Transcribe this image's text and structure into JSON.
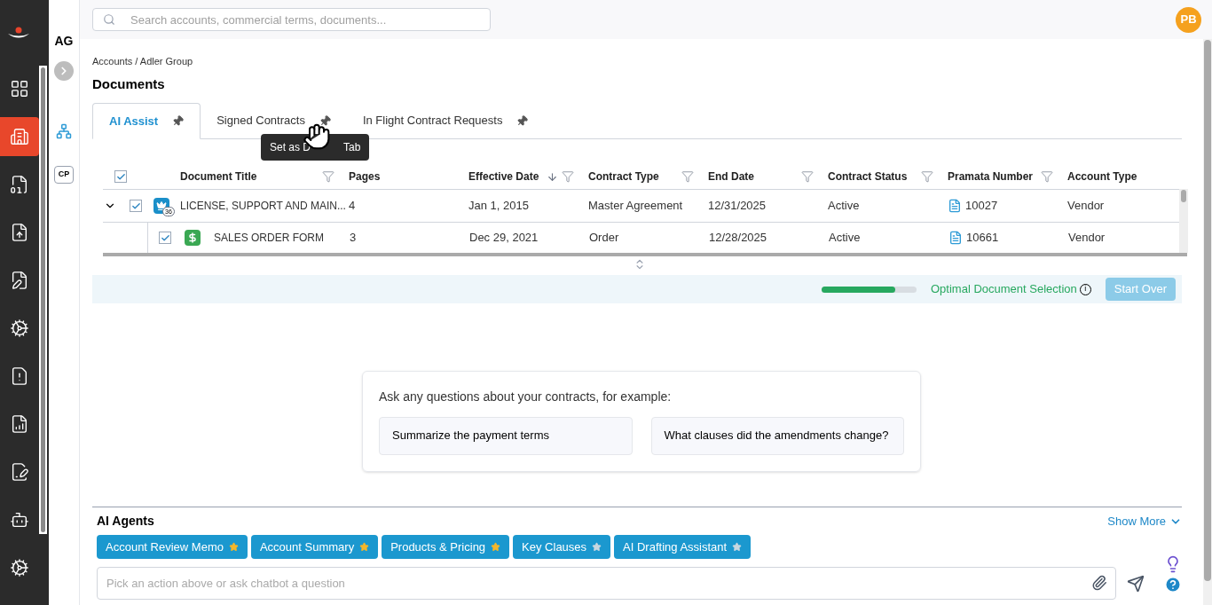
{
  "top_bar": {
    "search": {
      "placeholder": "Search accounts, commercial terms, documents..."
    },
    "avatar": "PB"
  },
  "nav": {
    "items": [
      {
        "kind": "grid",
        "selected": false
      },
      {
        "kind": "building",
        "selected": true
      },
      {
        "kind": "dollar-doc",
        "selected": false
      },
      {
        "kind": "upload-doc",
        "selected": false
      },
      {
        "kind": "edit-doc",
        "selected": false
      },
      {
        "kind": "gear",
        "selected": false
      },
      {
        "kind": "warning-doc",
        "selected": false
      },
      {
        "kind": "chart-doc",
        "selected": false
      },
      {
        "kind": "sign-doc",
        "selected": false
      },
      {
        "kind": "bot",
        "selected": false
      },
      {
        "kind": "gear",
        "selected": false
      }
    ]
  },
  "account_rail": {
    "initials": "AG",
    "tag": "CP"
  },
  "breadcrumb": "Accounts / Adler Group",
  "page_title": "Documents",
  "tabs": [
    {
      "label": "AI Assist",
      "selected": true
    },
    {
      "label": "Signed Contracts",
      "selected": false
    },
    {
      "label": "In Flight Contract Requests",
      "selected": false
    }
  ],
  "tooltip": {
    "before": "Set as D",
    "after": "Tab"
  },
  "table": {
    "header_checked": true,
    "columns": [
      {
        "label": "Document Title",
        "filter": true,
        "sorted": false
      },
      {
        "label": "Pages",
        "filter": false,
        "sorted": false
      },
      {
        "label": "Effective Date",
        "filter": true,
        "sorted": true
      },
      {
        "label": "Contract Type",
        "filter": true,
        "sorted": false
      },
      {
        "label": "End Date",
        "filter": true,
        "sorted": false
      },
      {
        "label": "Contract Status",
        "filter": true,
        "sorted": false
      },
      {
        "label": "Pramata Number",
        "filter": true,
        "sorted": false
      },
      {
        "label": "Account Type",
        "filter": false,
        "sorted": false
      }
    ],
    "rows": [
      {
        "checked": true,
        "expanded": true,
        "kind": "master",
        "badge": "36",
        "cells": [
          "LICENSE, SUPPORT AND MAIN...",
          "4",
          "Jan 1, 2015",
          "Master Agreement",
          "12/31/2025",
          "Active",
          "10027",
          "Vendor"
        ],
        "children": [
          {
            "checked": true,
            "kind": "order",
            "cells": [
              "SALES ORDER FORM",
              "3",
              "Dec 29, 2021",
              "Order",
              "12/28/2025",
              "Active",
              "10661",
              "Vendor"
            ]
          }
        ]
      }
    ]
  },
  "selection_bar": {
    "level": 0.78,
    "label": "Optimal Document Selection",
    "info": "i",
    "button": "Start Over"
  },
  "prompt_card": {
    "text": "Ask any questions about your contracts, for example:",
    "suggestions": [
      "Summarize the payment terms",
      "What clauses did the amendments change?"
    ]
  },
  "agents": {
    "title": "AI Agents",
    "show_more": "Show More",
    "items": [
      {
        "label": "Account Review Memo",
        "starred": true
      },
      {
        "label": "Account Summary",
        "starred": true
      },
      {
        "label": "Products & Pricing",
        "starred": true
      },
      {
        "label": "Key Clauses",
        "starred": false
      },
      {
        "label": "AI Drafting Assistant",
        "starred": false
      }
    ]
  },
  "chat_input": {
    "placeholder": "Pick an action above or ask chatbot a question"
  }
}
